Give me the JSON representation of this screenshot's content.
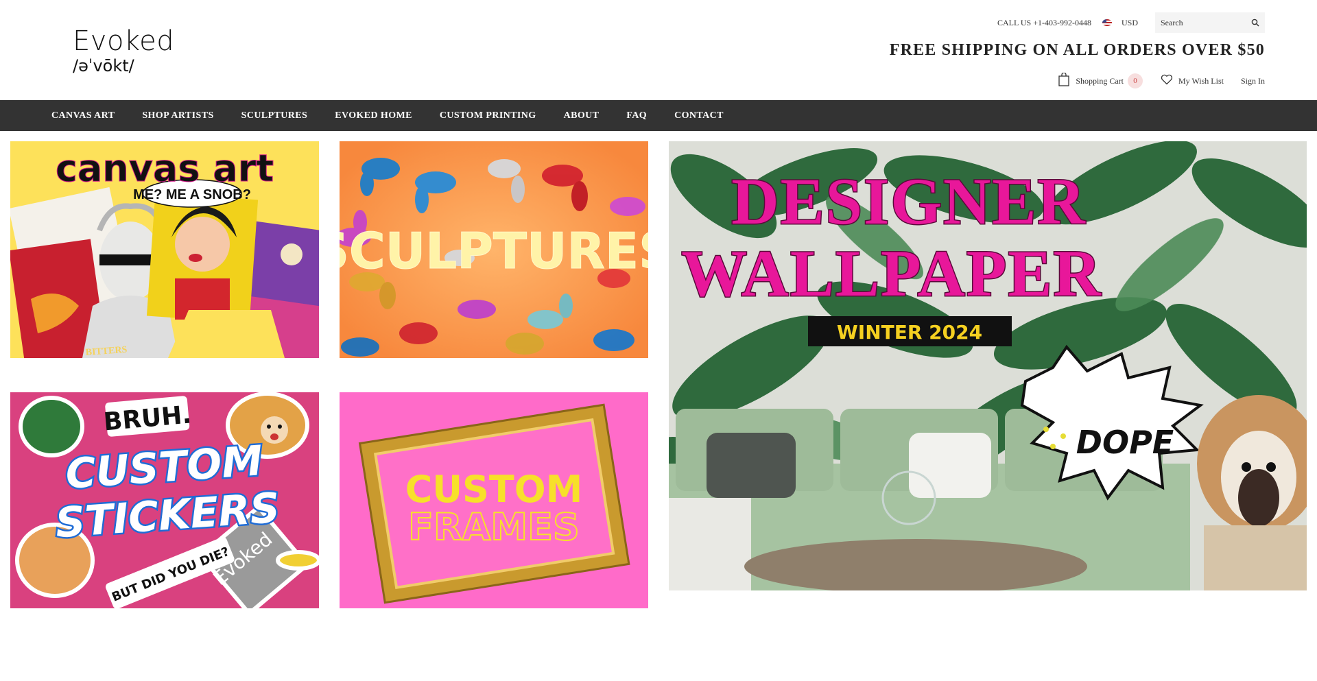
{
  "header": {
    "logo": {
      "word": "Evoked",
      "phonetic": "/əˈvōkt/"
    },
    "call_us": "CALL US +1-403-992-0448",
    "currency": "USD",
    "search_placeholder": "Search",
    "shipping_banner": "FREE SHIPPING ON ALL ORDERS OVER $50",
    "cart_label": "Shopping Cart",
    "cart_count": "0",
    "wishlist_label": "My Wish List",
    "signin_label": "Sign In"
  },
  "nav": {
    "items": [
      {
        "label": "CANVAS ART"
      },
      {
        "label": "SHOP ARTISTS"
      },
      {
        "label": "SCULPTURES"
      },
      {
        "label": "EVOKED HOME"
      },
      {
        "label": "CUSTOM PRINTING"
      },
      {
        "label": "ABOUT"
      },
      {
        "label": "FAQ"
      },
      {
        "label": "CONTACT"
      }
    ]
  },
  "tiles": {
    "canvas": {
      "title": "canvas art",
      "bubble": "ME? ME A SNOB?",
      "bitters": "BITTERS"
    },
    "sculptures": {
      "title": "SCULPTURES"
    },
    "stickers": {
      "line1": "CUSTOM",
      "line2": "STICKERS",
      "bruh": "BRUH.",
      "die": "BUT DID YOU DIE?",
      "brand": "Evoked"
    },
    "frames": {
      "line1": "CUSTOM",
      "line2": "FRAMES"
    },
    "wallpaper": {
      "line1": "DESIGNER",
      "line2": "WALLPAPER",
      "season": "WINTER 2024",
      "dope": "DOPE"
    }
  },
  "colors": {
    "nav_bg": "#333333",
    "canvas_bg": "#fde15a",
    "sculpt_bg": "#f99a4e",
    "sticker_bg": "#d9417f",
    "frames_bg": "#ff6bc9",
    "wall_pink": "#e8179a",
    "season_yellow": "#f5d020"
  }
}
